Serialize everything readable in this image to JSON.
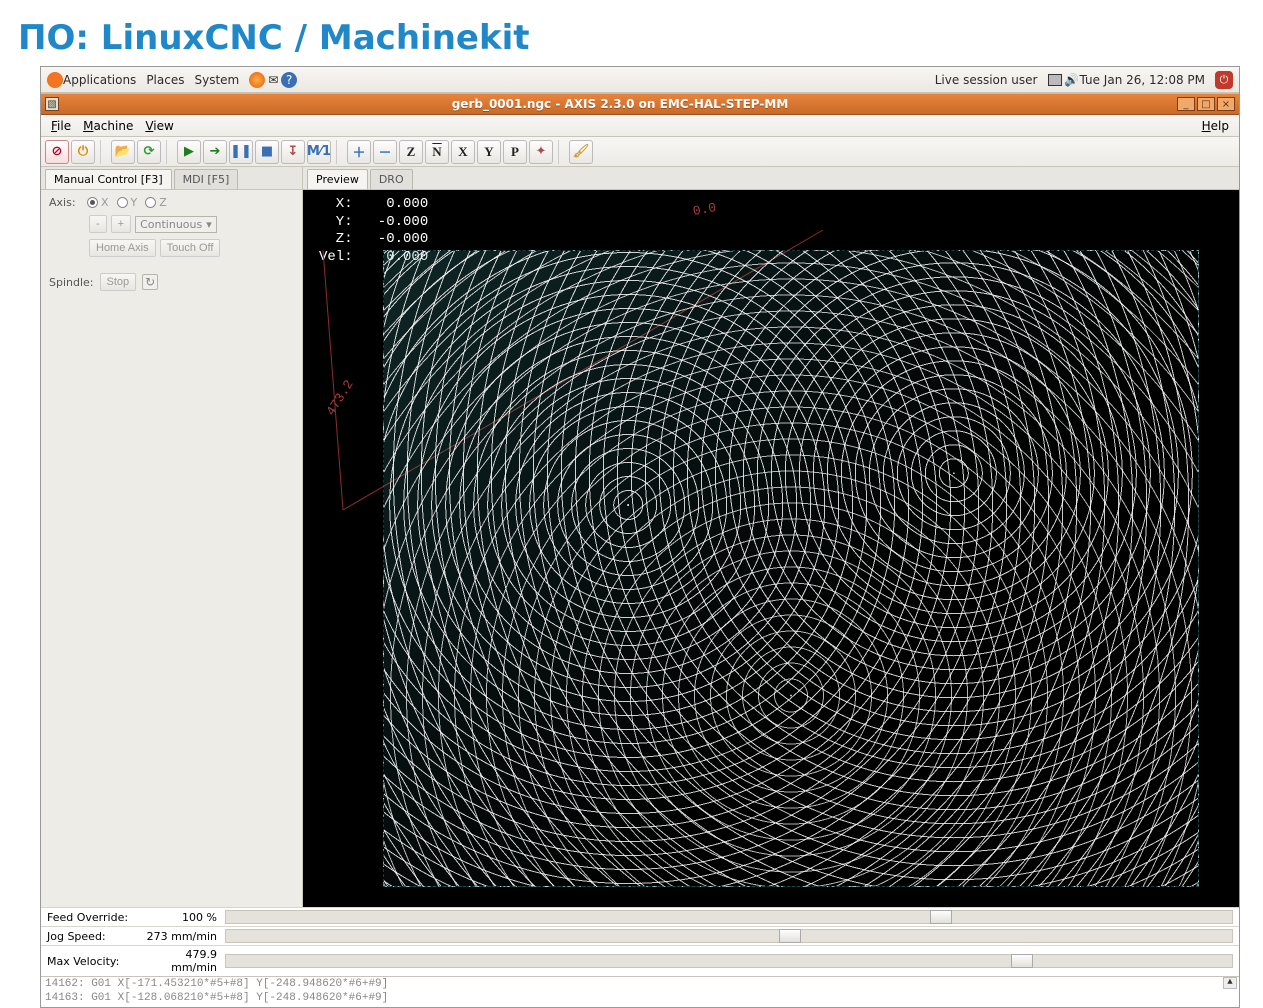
{
  "slide": {
    "title": "ПО: LinuxCNC / Machinekit"
  },
  "panel": {
    "apps": "Applications",
    "places": "Places",
    "system": "System",
    "user": "Live session user",
    "clock": "Tue Jan 26, 12:08 PM"
  },
  "window": {
    "title": "gerb_0001.ngc - AXIS 2.3.0 on EMC-HAL-STEP-MM"
  },
  "menubar": {
    "file": "File",
    "machine": "Machine",
    "view": "View",
    "help": "Help"
  },
  "toolbar": {
    "letters": {
      "z": "Z",
      "n": "N",
      "x": "X",
      "y": "Y",
      "p": "P"
    }
  },
  "left": {
    "tabs": {
      "manual": "Manual Control [F3]",
      "mdi": "MDI [F5]"
    },
    "axis_label": "Axis:",
    "axes": {
      "x": "X",
      "y": "Y",
      "z": "Z"
    },
    "jog_minus": "-",
    "jog_plus": "+",
    "continuous": "Continuous",
    "home_axis": "Home Axis",
    "touch_off": "Touch Off",
    "spindle_label": "Spindle:",
    "spindle_stop": "Stop"
  },
  "sliders": {
    "feed": {
      "label": "Feed Override:",
      "value": "100 %",
      "pos": 70
    },
    "jog": {
      "label": "Jog Speed:",
      "value": "273 mm/min",
      "pos": 55
    },
    "maxv": {
      "label": "Max Velocity:",
      "value": "479.9 mm/min",
      "pos": 78
    }
  },
  "right": {
    "tabs": {
      "preview": "Preview",
      "dro": "DRO"
    },
    "dro_lines": "  X:    0.000\n  Y:   -0.000\n  Z:   -0.000\nVel:    0.000",
    "ruler_a": "0.0",
    "ruler_b": "473.2"
  },
  "footer": {
    "l1": "14162: G01 X[-171.453210*#5+#8] Y[-248.948620*#6+#9]",
    "l2": "14163: G01 X[-128.068210*#5+#8] Y[-248.948620*#6+#9]"
  }
}
